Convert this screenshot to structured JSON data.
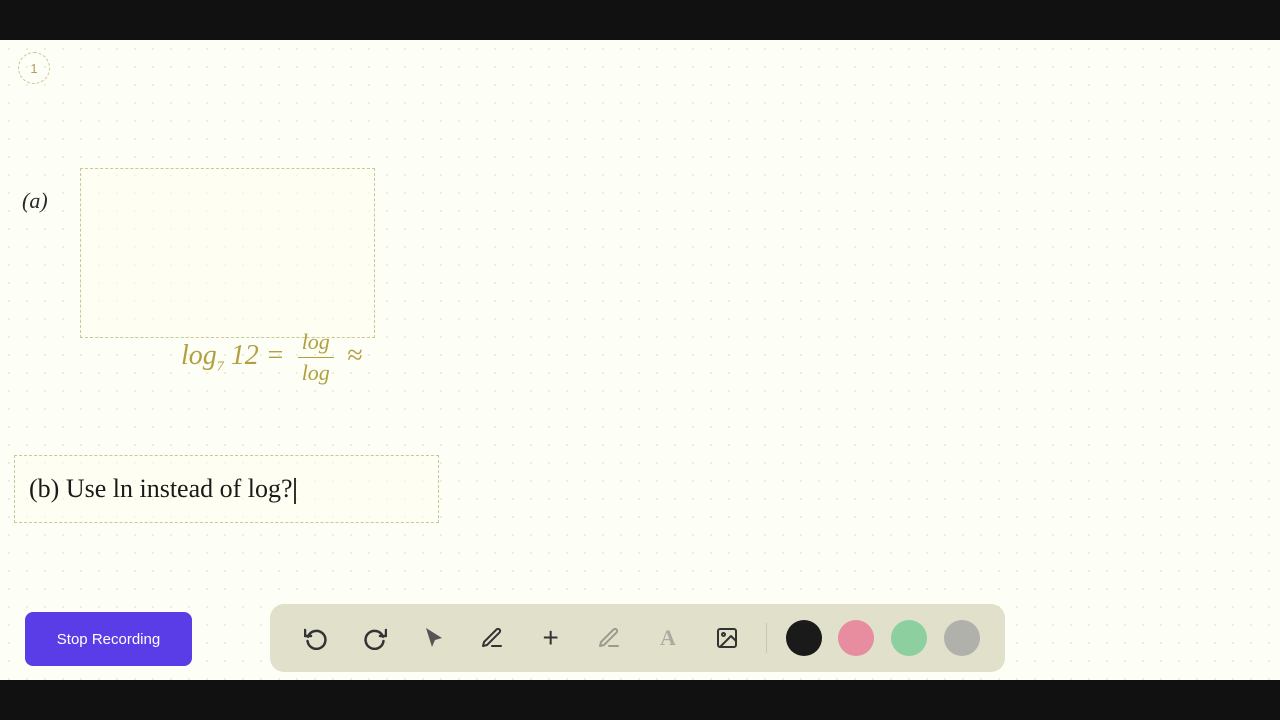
{
  "topBar": {
    "background": "#111"
  },
  "bottomBar": {
    "background": "#111"
  },
  "pageNumber": "1",
  "partA": {
    "label": "(a)",
    "math": {
      "base": "log",
      "subscript": "7",
      "number": "12",
      "equals": "=",
      "numerator": "log",
      "denominator": "log",
      "approx": "≈"
    }
  },
  "partB": {
    "text": "(b) Use ln instead of log?"
  },
  "toolbar": {
    "tools": [
      {
        "name": "undo",
        "icon": "↩",
        "label": "Undo"
      },
      {
        "name": "redo",
        "icon": "↪",
        "label": "Redo"
      },
      {
        "name": "select",
        "icon": "▲",
        "label": "Select"
      },
      {
        "name": "pen",
        "icon": "✏",
        "label": "Pen"
      },
      {
        "name": "add",
        "icon": "+",
        "label": "Add"
      },
      {
        "name": "highlighter",
        "icon": "✏",
        "label": "Highlighter"
      },
      {
        "name": "text",
        "icon": "A",
        "label": "Text"
      },
      {
        "name": "image",
        "icon": "🖼",
        "label": "Image"
      }
    ],
    "colors": [
      {
        "name": "black",
        "value": "#1a1a1a"
      },
      {
        "name": "pink",
        "value": "#e87090"
      },
      {
        "name": "green",
        "value": "#70c890"
      },
      {
        "name": "gray",
        "value": "#a0a0a0"
      }
    ]
  },
  "stopRecording": {
    "label": "Stop Recording",
    "bgColor": "#5b3de8"
  }
}
